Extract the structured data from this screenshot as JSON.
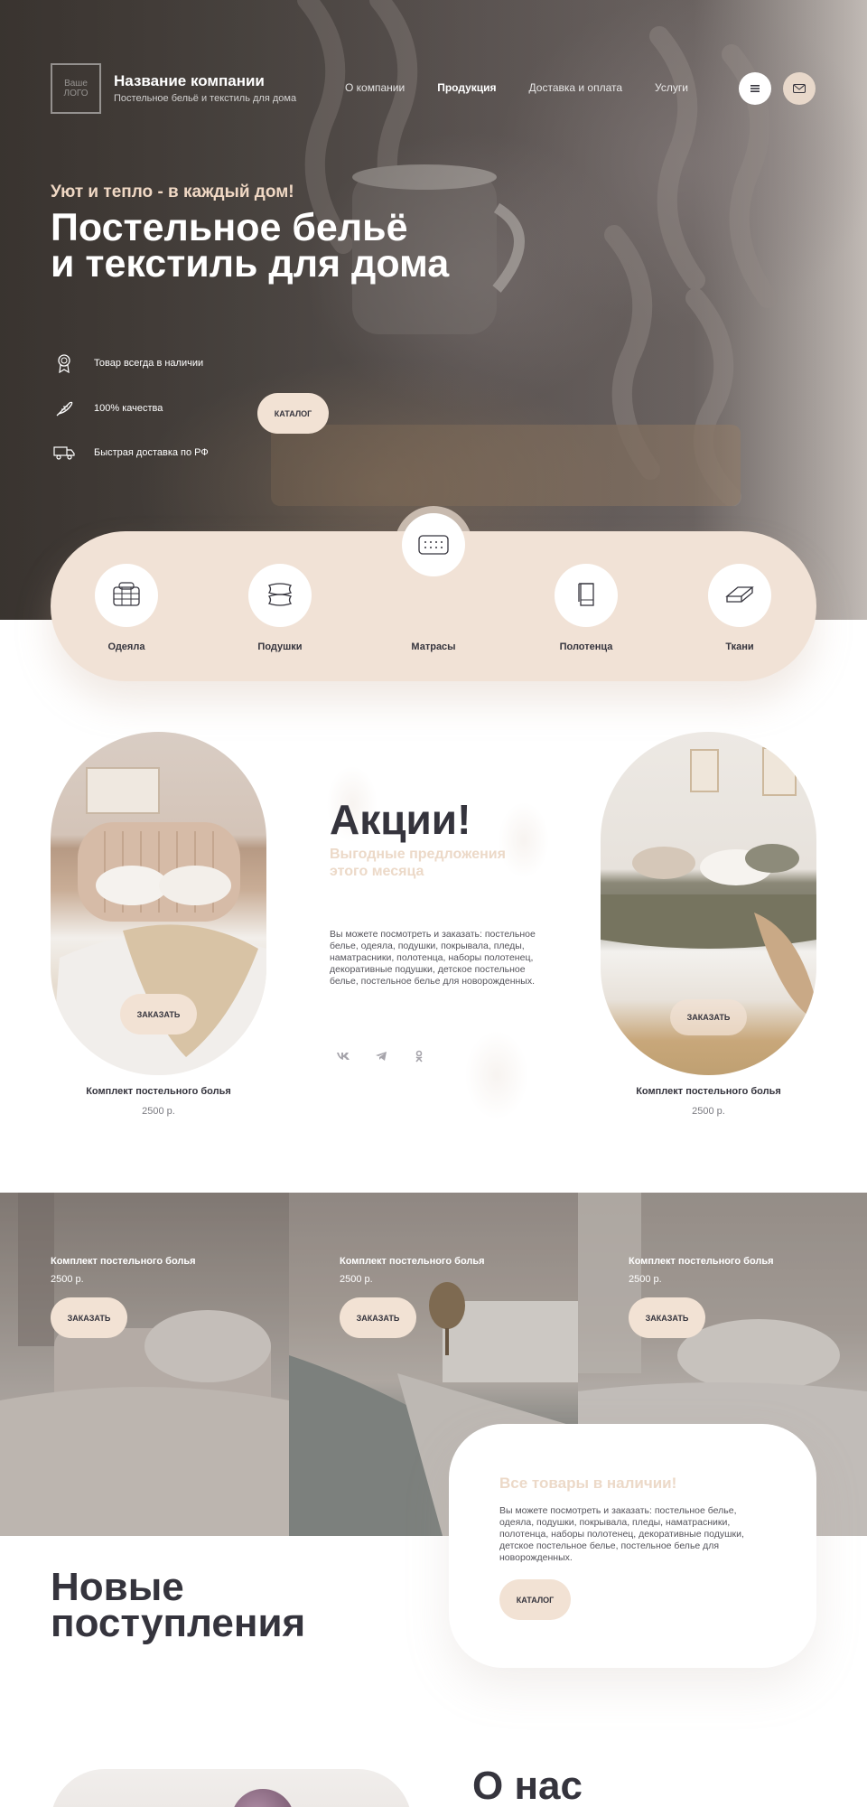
{
  "header": {
    "logo_line1": "Ваше",
    "logo_line2": "ЛОГО",
    "company_name": "Название компании",
    "company_tagline": "Постельное бельё и текстиль для дома",
    "nav": [
      {
        "label": "О компании",
        "active": false
      },
      {
        "label": "Продукция",
        "active": true
      },
      {
        "label": "Доставка и оплата",
        "active": false
      },
      {
        "label": "Услуги",
        "active": false
      }
    ],
    "menu_icon": "menu-icon",
    "mail_icon": "mail-icon"
  },
  "hero": {
    "kicker": "Уют и тепло - в каждый дом!",
    "title_line1": "Постельное бельё",
    "title_line2": "и текстиль для дома",
    "features": [
      {
        "icon": "badge-icon",
        "label": "Товар всегда в наличии"
      },
      {
        "icon": "feather-icon",
        "label": "100% качества"
      },
      {
        "icon": "truck-icon",
        "label": "Быстрая доставка по РФ"
      }
    ],
    "catalog_button": "КАТАЛОГ"
  },
  "categories": [
    {
      "icon": "blanket-icon",
      "label": "Одеяла"
    },
    {
      "icon": "pillow-icon",
      "label": "Подушки"
    },
    {
      "icon": "mattress-icon",
      "label": "Матрасы"
    },
    {
      "icon": "towel-icon",
      "label": "Полотенца"
    },
    {
      "icon": "fabric-icon",
      "label": "Ткани"
    }
  ],
  "promo": {
    "title": "Акции!",
    "subtitle": "Выгодные предложения этого месяца",
    "text": "Вы можете посмотреть и заказать: постельное белье, одеяла, подушки, покрывала, пледы, наматрасники, полотенца, наборы полотенец, декоративные подушки, детское постельное белье, постельное белье для новорожденных.",
    "social": [
      "vk-icon",
      "telegram-icon",
      "odnoklassniki-icon"
    ],
    "left_card": {
      "name": "Комплект постельного болья",
      "price": "2500 р.",
      "button": "ЗАКАЗАТЬ"
    },
    "right_card": {
      "name": "Комплект постельного болья",
      "price": "2500 р.",
      "button": "ЗАКАЗАТЬ"
    }
  },
  "products": [
    {
      "name": "Комплект постельного болья",
      "price": "2500 р.",
      "button": "ЗАКАЗАТЬ"
    },
    {
      "name": "Комплект постельного болья",
      "price": "2500 р.",
      "button": "ЗАКАЗАТЬ"
    },
    {
      "name": "Комплект постельного болья",
      "price": "2500 р.",
      "button": "ЗАКАЗАТЬ"
    }
  ],
  "stock": {
    "title": "Все товары в наличии!",
    "text": "Вы можете посмотреть и заказать: постельное белье, одеяла, подушки, покрывала, пледы, наматрасники, полотенца, наборы полотенец, декоративные подушки, детское постельное белье, постельное белье для новорожденных.",
    "button": "КАТАЛОГ"
  },
  "new_arrivals": {
    "line1": "Новые",
    "line2": "поступления"
  },
  "about": {
    "title": "О нас"
  },
  "colors": {
    "accent": "#f2e2d4",
    "dark": "#35343d",
    "muted_accent": "#ecd9c8"
  }
}
